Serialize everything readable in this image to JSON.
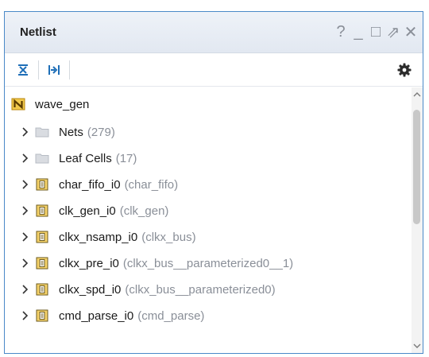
{
  "panel": {
    "title": "Netlist",
    "controls": [
      "?",
      "_",
      "□",
      "⇗",
      "✕"
    ]
  },
  "toolbar": {
    "collapse_all_icon": "collapse-all-icon",
    "expand_all_icon": "expand-all-icon",
    "settings_icon": "gear-icon"
  },
  "tree": {
    "root": {
      "label": "wave_gen",
      "icon": "netlist-n-icon"
    },
    "items": [
      {
        "name": "Nets",
        "sub": "(279)",
        "icon": "folder-icon"
      },
      {
        "name": "Leaf Cells",
        "sub": "(17)",
        "icon": "folder-icon"
      },
      {
        "name": "char_fifo_i0",
        "sub": "(char_fifo)",
        "icon": "cell-instance-icon"
      },
      {
        "name": "clk_gen_i0",
        "sub": "(clk_gen)",
        "icon": "cell-instance-icon"
      },
      {
        "name": "clkx_nsamp_i0",
        "sub": "(clkx_bus)",
        "icon": "cell-instance-icon"
      },
      {
        "name": "clkx_pre_i0",
        "sub": "(clkx_bus__parameterized0__1)",
        "icon": "cell-instance-icon"
      },
      {
        "name": "clkx_spd_i0",
        "sub": "(clkx_bus__parameterized0)",
        "icon": "cell-instance-icon"
      },
      {
        "name": "cmd_parse_i0",
        "sub": "(cmd_parse)",
        "icon": "cell-instance-icon"
      }
    ]
  },
  "colors": {
    "accent_border": "#4a89c8",
    "toolbar_icon": "#1f6fb8",
    "muted_text": "#8a8f98"
  }
}
